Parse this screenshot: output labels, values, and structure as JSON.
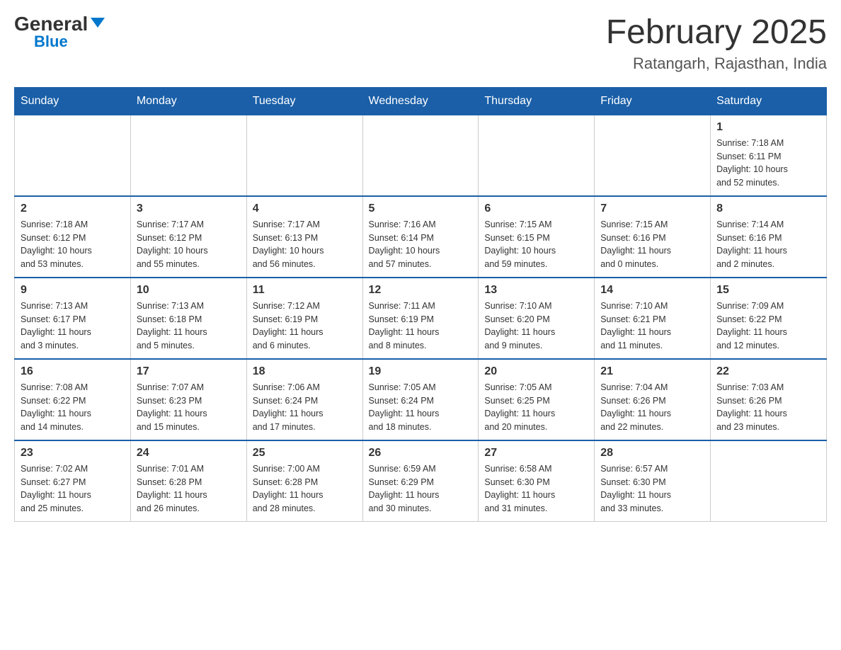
{
  "header": {
    "logo_general": "General",
    "logo_blue": "Blue",
    "month": "February 2025",
    "location": "Ratangarh, Rajasthan, India"
  },
  "days_of_week": [
    "Sunday",
    "Monday",
    "Tuesday",
    "Wednesday",
    "Thursday",
    "Friday",
    "Saturday"
  ],
  "weeks": [
    [
      {
        "day": "",
        "info": ""
      },
      {
        "day": "",
        "info": ""
      },
      {
        "day": "",
        "info": ""
      },
      {
        "day": "",
        "info": ""
      },
      {
        "day": "",
        "info": ""
      },
      {
        "day": "",
        "info": ""
      },
      {
        "day": "1",
        "info": "Sunrise: 7:18 AM\nSunset: 6:11 PM\nDaylight: 10 hours\nand 52 minutes."
      }
    ],
    [
      {
        "day": "2",
        "info": "Sunrise: 7:18 AM\nSunset: 6:12 PM\nDaylight: 10 hours\nand 53 minutes."
      },
      {
        "day": "3",
        "info": "Sunrise: 7:17 AM\nSunset: 6:12 PM\nDaylight: 10 hours\nand 55 minutes."
      },
      {
        "day": "4",
        "info": "Sunrise: 7:17 AM\nSunset: 6:13 PM\nDaylight: 10 hours\nand 56 minutes."
      },
      {
        "day": "5",
        "info": "Sunrise: 7:16 AM\nSunset: 6:14 PM\nDaylight: 10 hours\nand 57 minutes."
      },
      {
        "day": "6",
        "info": "Sunrise: 7:15 AM\nSunset: 6:15 PM\nDaylight: 10 hours\nand 59 minutes."
      },
      {
        "day": "7",
        "info": "Sunrise: 7:15 AM\nSunset: 6:16 PM\nDaylight: 11 hours\nand 0 minutes."
      },
      {
        "day": "8",
        "info": "Sunrise: 7:14 AM\nSunset: 6:16 PM\nDaylight: 11 hours\nand 2 minutes."
      }
    ],
    [
      {
        "day": "9",
        "info": "Sunrise: 7:13 AM\nSunset: 6:17 PM\nDaylight: 11 hours\nand 3 minutes."
      },
      {
        "day": "10",
        "info": "Sunrise: 7:13 AM\nSunset: 6:18 PM\nDaylight: 11 hours\nand 5 minutes."
      },
      {
        "day": "11",
        "info": "Sunrise: 7:12 AM\nSunset: 6:19 PM\nDaylight: 11 hours\nand 6 minutes."
      },
      {
        "day": "12",
        "info": "Sunrise: 7:11 AM\nSunset: 6:19 PM\nDaylight: 11 hours\nand 8 minutes."
      },
      {
        "day": "13",
        "info": "Sunrise: 7:10 AM\nSunset: 6:20 PM\nDaylight: 11 hours\nand 9 minutes."
      },
      {
        "day": "14",
        "info": "Sunrise: 7:10 AM\nSunset: 6:21 PM\nDaylight: 11 hours\nand 11 minutes."
      },
      {
        "day": "15",
        "info": "Sunrise: 7:09 AM\nSunset: 6:22 PM\nDaylight: 11 hours\nand 12 minutes."
      }
    ],
    [
      {
        "day": "16",
        "info": "Sunrise: 7:08 AM\nSunset: 6:22 PM\nDaylight: 11 hours\nand 14 minutes."
      },
      {
        "day": "17",
        "info": "Sunrise: 7:07 AM\nSunset: 6:23 PM\nDaylight: 11 hours\nand 15 minutes."
      },
      {
        "day": "18",
        "info": "Sunrise: 7:06 AM\nSunset: 6:24 PM\nDaylight: 11 hours\nand 17 minutes."
      },
      {
        "day": "19",
        "info": "Sunrise: 7:05 AM\nSunset: 6:24 PM\nDaylight: 11 hours\nand 18 minutes."
      },
      {
        "day": "20",
        "info": "Sunrise: 7:05 AM\nSunset: 6:25 PM\nDaylight: 11 hours\nand 20 minutes."
      },
      {
        "day": "21",
        "info": "Sunrise: 7:04 AM\nSunset: 6:26 PM\nDaylight: 11 hours\nand 22 minutes."
      },
      {
        "day": "22",
        "info": "Sunrise: 7:03 AM\nSunset: 6:26 PM\nDaylight: 11 hours\nand 23 minutes."
      }
    ],
    [
      {
        "day": "23",
        "info": "Sunrise: 7:02 AM\nSunset: 6:27 PM\nDaylight: 11 hours\nand 25 minutes."
      },
      {
        "day": "24",
        "info": "Sunrise: 7:01 AM\nSunset: 6:28 PM\nDaylight: 11 hours\nand 26 minutes."
      },
      {
        "day": "25",
        "info": "Sunrise: 7:00 AM\nSunset: 6:28 PM\nDaylight: 11 hours\nand 28 minutes."
      },
      {
        "day": "26",
        "info": "Sunrise: 6:59 AM\nSunset: 6:29 PM\nDaylight: 11 hours\nand 30 minutes."
      },
      {
        "day": "27",
        "info": "Sunrise: 6:58 AM\nSunset: 6:30 PM\nDaylight: 11 hours\nand 31 minutes."
      },
      {
        "day": "28",
        "info": "Sunrise: 6:57 AM\nSunset: 6:30 PM\nDaylight: 11 hours\nand 33 minutes."
      },
      {
        "day": "",
        "info": ""
      }
    ]
  ]
}
